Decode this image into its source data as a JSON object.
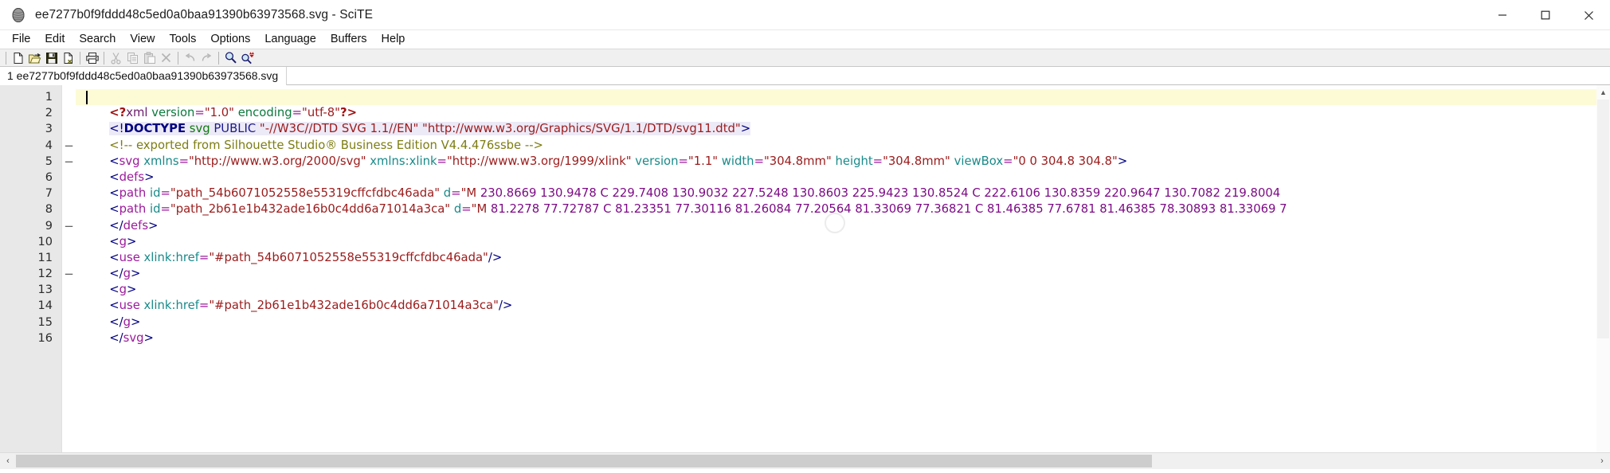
{
  "window": {
    "title": "ee7277b0f9fddd48c5ed0a0baa91390b63973568.svg - SciTE",
    "app_icon": "scite-icon",
    "controls": [
      {
        "name": "minimize",
        "glyph": "minimize-icon"
      },
      {
        "name": "maximize",
        "glyph": "maximize-icon"
      },
      {
        "name": "close",
        "glyph": "close-icon"
      }
    ]
  },
  "menubar": {
    "items": [
      {
        "label": "File"
      },
      {
        "label": "Edit"
      },
      {
        "label": "Search"
      },
      {
        "label": "View"
      },
      {
        "label": "Tools"
      },
      {
        "label": "Options"
      },
      {
        "label": "Language"
      },
      {
        "label": "Buffers"
      },
      {
        "label": "Help"
      }
    ]
  },
  "toolbar": {
    "buttons": [
      {
        "name": "new-file-icon",
        "label": "New",
        "enabled": true
      },
      {
        "name": "open-file-icon",
        "label": "Open",
        "enabled": true
      },
      {
        "name": "save-icon",
        "label": "Save",
        "enabled": true
      },
      {
        "name": "close-file-icon",
        "label": "Close",
        "enabled": true
      },
      {
        "name": "separator",
        "label": "",
        "enabled": true
      },
      {
        "name": "print-icon",
        "label": "Print",
        "enabled": true
      },
      {
        "name": "separator",
        "label": "",
        "enabled": true
      },
      {
        "name": "cut-icon",
        "label": "Cut",
        "enabled": false
      },
      {
        "name": "copy-icon",
        "label": "Copy",
        "enabled": false
      },
      {
        "name": "paste-icon",
        "label": "Paste",
        "enabled": false
      },
      {
        "name": "delete-icon",
        "label": "Delete",
        "enabled": false
      },
      {
        "name": "separator",
        "label": "",
        "enabled": true
      },
      {
        "name": "undo-icon",
        "label": "Undo",
        "enabled": false
      },
      {
        "name": "redo-icon",
        "label": "Redo",
        "enabled": false
      },
      {
        "name": "separator",
        "label": "",
        "enabled": true
      },
      {
        "name": "find-icon",
        "label": "Find",
        "enabled": true
      },
      {
        "name": "replace-icon",
        "label": "Replace",
        "enabled": true
      }
    ]
  },
  "tabs": [
    {
      "label": "1 ee7277b0f9fddd48c5ed0a0baa91390b63973568.svg",
      "active": true
    }
  ],
  "editor": {
    "line_numbers": [
      "1",
      "2",
      "3",
      "4",
      "5",
      "6",
      "7",
      "8",
      "9",
      "10",
      "11",
      "12",
      "13",
      "14",
      "15",
      "16"
    ],
    "fold_markers": {
      "4": "−",
      "5": "−",
      "9": "−",
      "12": "−"
    },
    "current_line": 1,
    "lines": [
      "<?xml version=\"1.0\" encoding=\"utf-8\"?>",
      "<!DOCTYPE svg PUBLIC \"-//W3C//DTD SVG 1.1//EN\" \"http://www.w3.org/Graphics/SVG/1.1/DTD/svg11.dtd\">",
      "<!-- exported from Silhouette Studio® Business Edition V4.4.476ssbe -->",
      "<svg xmlns=\"http://www.w3.org/2000/svg\" xmlns:xlink=\"http://www.w3.org/1999/xlink\" version=\"1.1\" width=\"304.8mm\" height=\"304.8mm\" viewBox=\"0 0 304.8 304.8\">",
      "<defs>",
      "<path id=\"path_54b6071052558e55319cffcfdbc46ada\" d=\"M 230.8669 130.9478 C 229.7408 130.9032 227.5248 130.8603 225.9423 130.8524 C 222.6106 130.8359 220.9647 130.7082 219.8004",
      "<path id=\"path_2b61e1b432ade16b0c4dd6a71014a3ca\" d=\"M 81.2278 77.72787 C 81.23351 77.30116 81.26084 77.20564 81.33069 77.36821 C 81.46385 77.6781 81.46385 78.30893 81.33069 7",
      "</defs>",
      "<g>",
      "<use xlink:href=\"#path_54b6071052558e55319cffcfdbc46ada\"/>",
      "</g>",
      "<g>",
      "<use xlink:href=\"#path_2b61e1b432ade16b0c4dd6a71014a3ca\"/>",
      "</g>",
      "</svg>",
      ""
    ]
  },
  "scrollbars": {
    "horizontal_left_arrow": "‹",
    "horizontal_right_arrow": "›",
    "vertical_up_arrow": "▲",
    "vertical_down_arrow": "▼"
  },
  "colors": {
    "gutter_bg": "#e8e8e8",
    "current_line_bg": "#fdfbd6",
    "selection_bg": "#edeaf7",
    "toolbar_bg": "#f0f0f0",
    "tag": "#9c1a9c",
    "attribute": "#1a8a8a",
    "value": "#9b1b1b",
    "comment": "#7d7d12",
    "punct": "#000080"
  }
}
